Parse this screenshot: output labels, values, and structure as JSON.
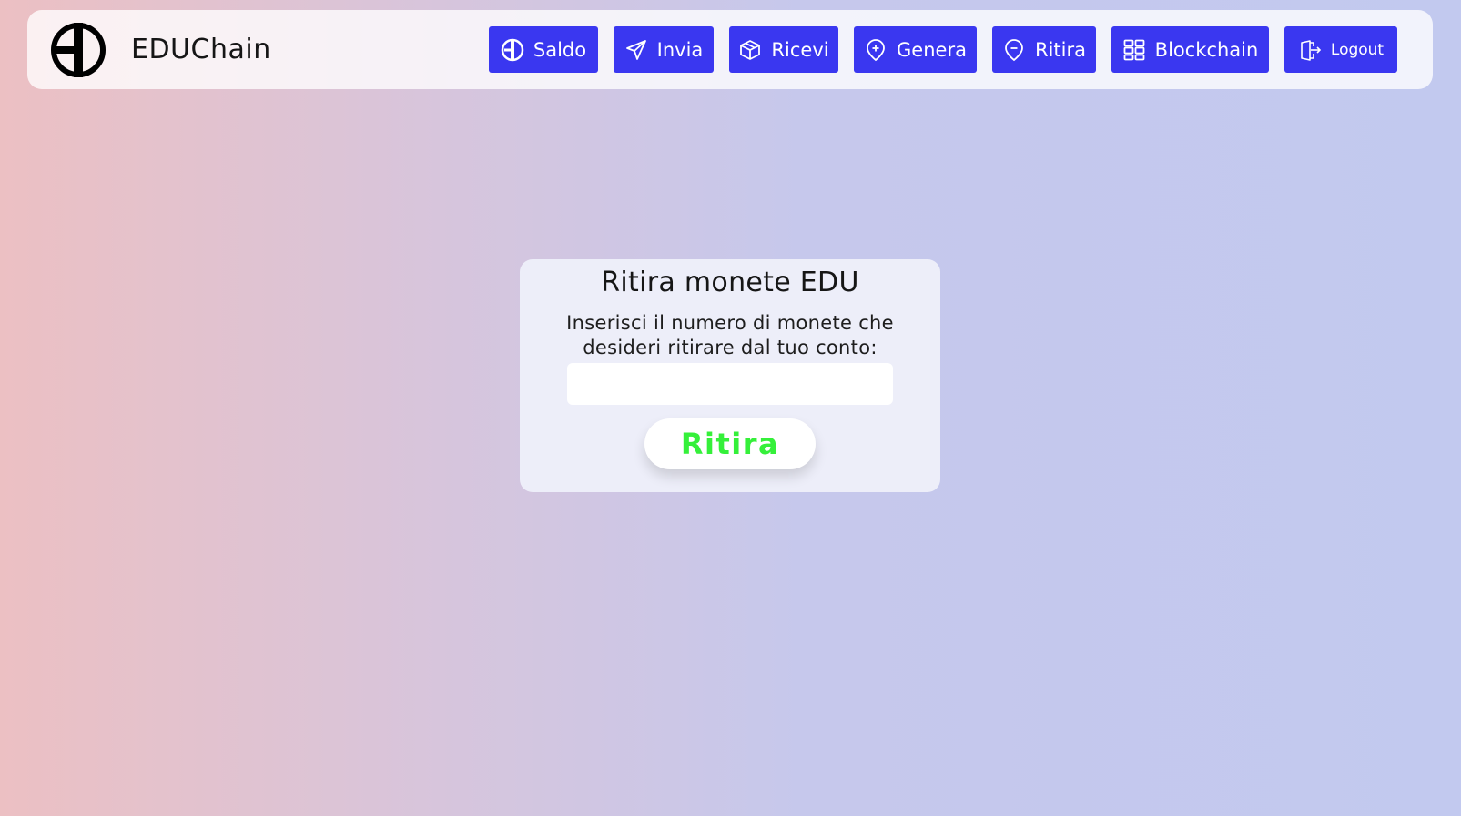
{
  "header": {
    "brand": "EDUChain",
    "logo_icon": "educhain-logo-icon"
  },
  "nav": {
    "saldo": {
      "label": "Saldo",
      "icon": "coin-icon"
    },
    "invia": {
      "label": "Invia",
      "icon": "send-icon"
    },
    "ricevi": {
      "label": "Ricevi",
      "icon": "box-icon"
    },
    "genera": {
      "label": "Genera",
      "icon": "shield-plus-icon"
    },
    "ritira": {
      "label": "Ritira",
      "icon": "shield-minus-icon"
    },
    "blockchain": {
      "label": "Blockchain",
      "icon": "grid-icon"
    },
    "logout": {
      "label": "Logout",
      "icon": "logout-icon"
    }
  },
  "withdraw": {
    "title": "Ritira monete EDU",
    "description": "Inserisci il numero di monete che desideri ritirare dal tuo conto:",
    "amount_value": "",
    "submit_label": "Ritira"
  },
  "colors": {
    "nav_button": "#3a37f0",
    "submit_text": "#35f03a",
    "card_background": "#edeef9"
  }
}
